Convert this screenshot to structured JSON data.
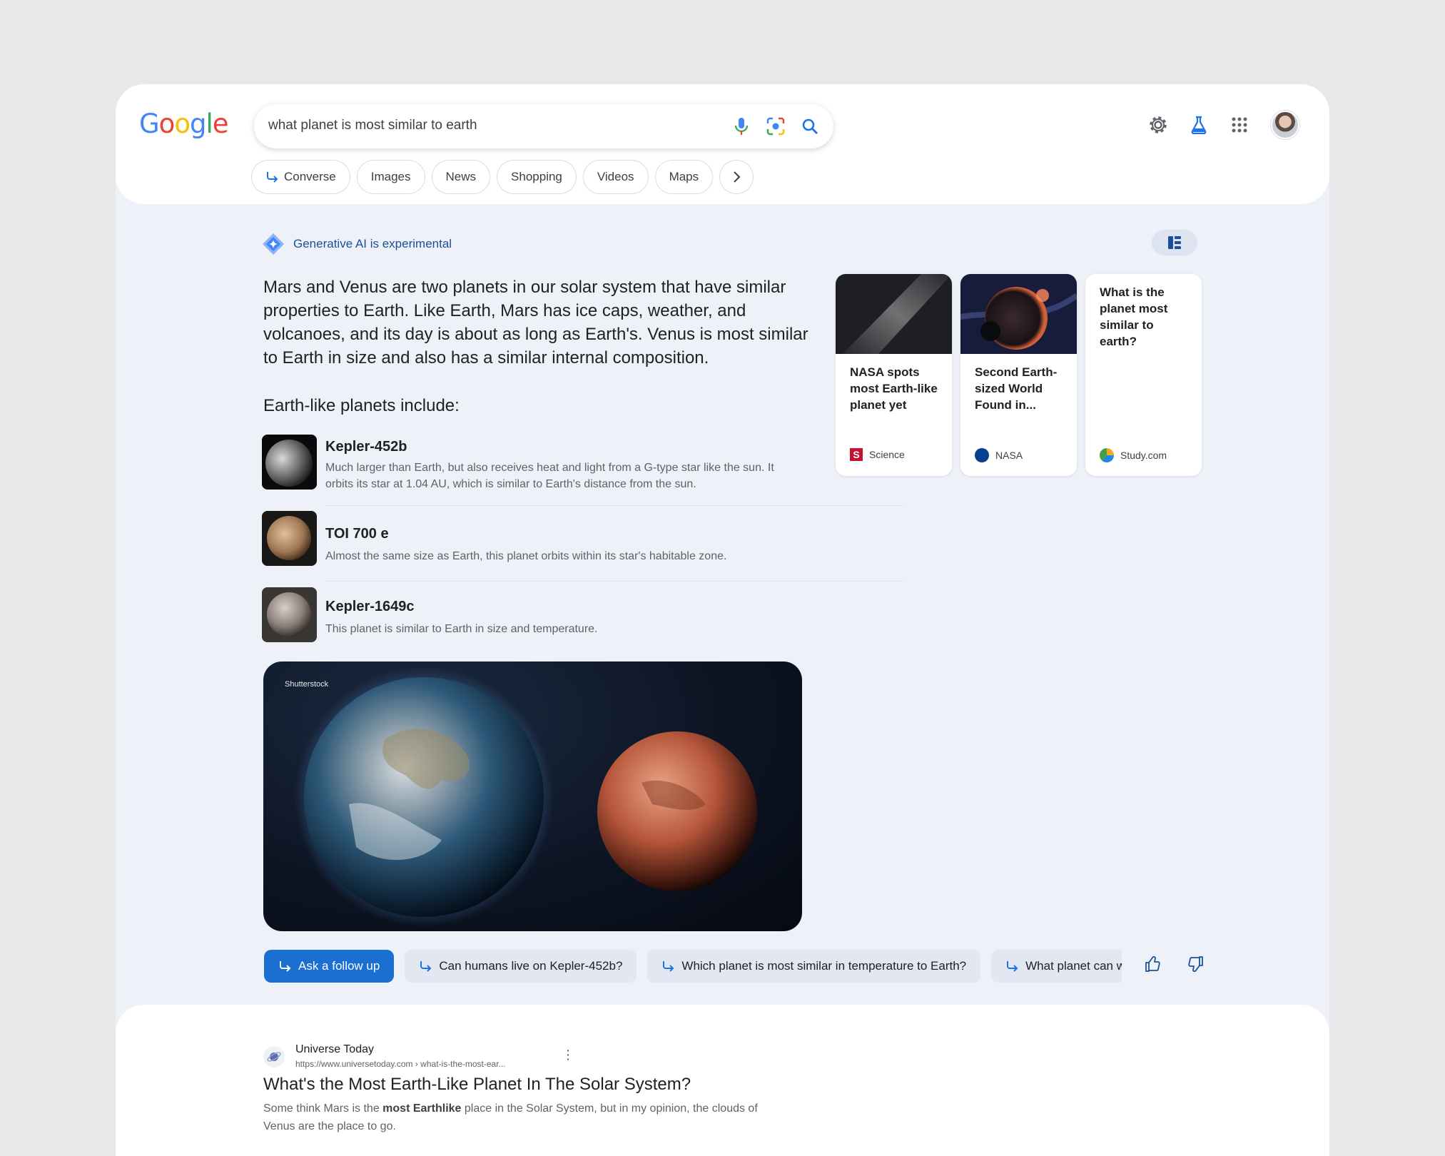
{
  "colors": {
    "accent": "#1a6fd1",
    "ai_text": "#1a4f9c",
    "background": "#eef1f8"
  },
  "header": {
    "logo_letters": [
      "G",
      "o",
      "o",
      "g",
      "l",
      "e"
    ],
    "search": {
      "query": "what planet is most similar to earth"
    },
    "icons": [
      "microphone-icon",
      "lens-icon",
      "search-icon",
      "settings-icon",
      "labs-flask-icon",
      "apps-grid-icon"
    ]
  },
  "tabs": [
    {
      "label": "Converse",
      "icon": "follow-up-arrow-icon"
    },
    {
      "label": "Images"
    },
    {
      "label": "News"
    },
    {
      "label": "Shopping"
    },
    {
      "label": "Videos"
    },
    {
      "label": "Maps"
    }
  ],
  "ai": {
    "badge": "Generative AI is experimental",
    "summary": "Mars and Venus are two planets in our solar system that have similar properties to Earth. Like Earth, Mars has ice caps, weather, and volcanoes, and its day is about as long as Earth's. Venus is most similar to Earth in size and also has a similar internal composition.",
    "subheading": "Earth-like planets include:",
    "planets": [
      {
        "name": "Kepler-452b",
        "description": "Much larger than Earth, but also receives heat and light from a G-type star like the sun. It orbits its star at 1.04 AU, which is similar to Earth's distance from the sun."
      },
      {
        "name": "TOI 700 e",
        "description": "Almost the same size as Earth, this planet orbits within its star's habitable zone."
      },
      {
        "name": "Kepler-1649c",
        "description": "This planet is similar to Earth in size and temperature."
      }
    ],
    "image_credit": "Shutterstock",
    "sources": [
      {
        "title": "NASA spots most Earth-like planet yet",
        "source": "Science",
        "source_glyph": "S"
      },
      {
        "title": "Second Earth-sized World Found in...",
        "source": "NASA"
      },
      {
        "title": "What is the planet most similar to earth?",
        "source": "Study.com"
      }
    ],
    "followups": [
      {
        "label": "Ask a follow up"
      },
      {
        "label": "Can humans live on Kepler-452b?"
      },
      {
        "label": "Which planet is most similar in temperature to Earth?"
      },
      {
        "label": "What planet can we live on besides Earth?"
      }
    ]
  },
  "result": {
    "site": "Universe Today",
    "url": "https://www.universetoday.com › what-is-the-most-ear...",
    "more": "⋮",
    "title": "What's the Most Earth-Like Planet In The Solar System?",
    "snippet_before": "Some think Mars is the ",
    "snippet_bold": "most Earthlike",
    "snippet_after": " place in the Solar System, but in my opinion, the clouds of Venus are the place to go."
  }
}
